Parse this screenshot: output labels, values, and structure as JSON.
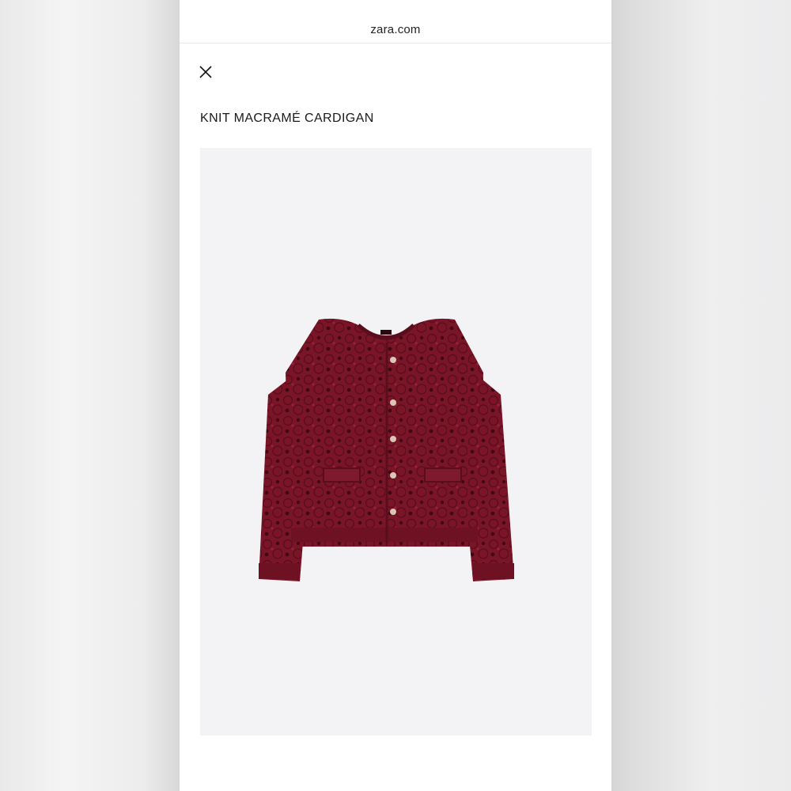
{
  "browser": {
    "url_display": "zara.com"
  },
  "product": {
    "title": "KNIT MACRAMÉ CARDIGAN",
    "image": {
      "subject": "cardigan-photo",
      "color": "#7a1528",
      "background": "#f3f3f5"
    }
  },
  "icons": {
    "close": "close-icon"
  },
  "colors": {
    "page_bg": "#ffffff",
    "side_bg": "#e9e9ea",
    "text": "#1a1a1a"
  }
}
